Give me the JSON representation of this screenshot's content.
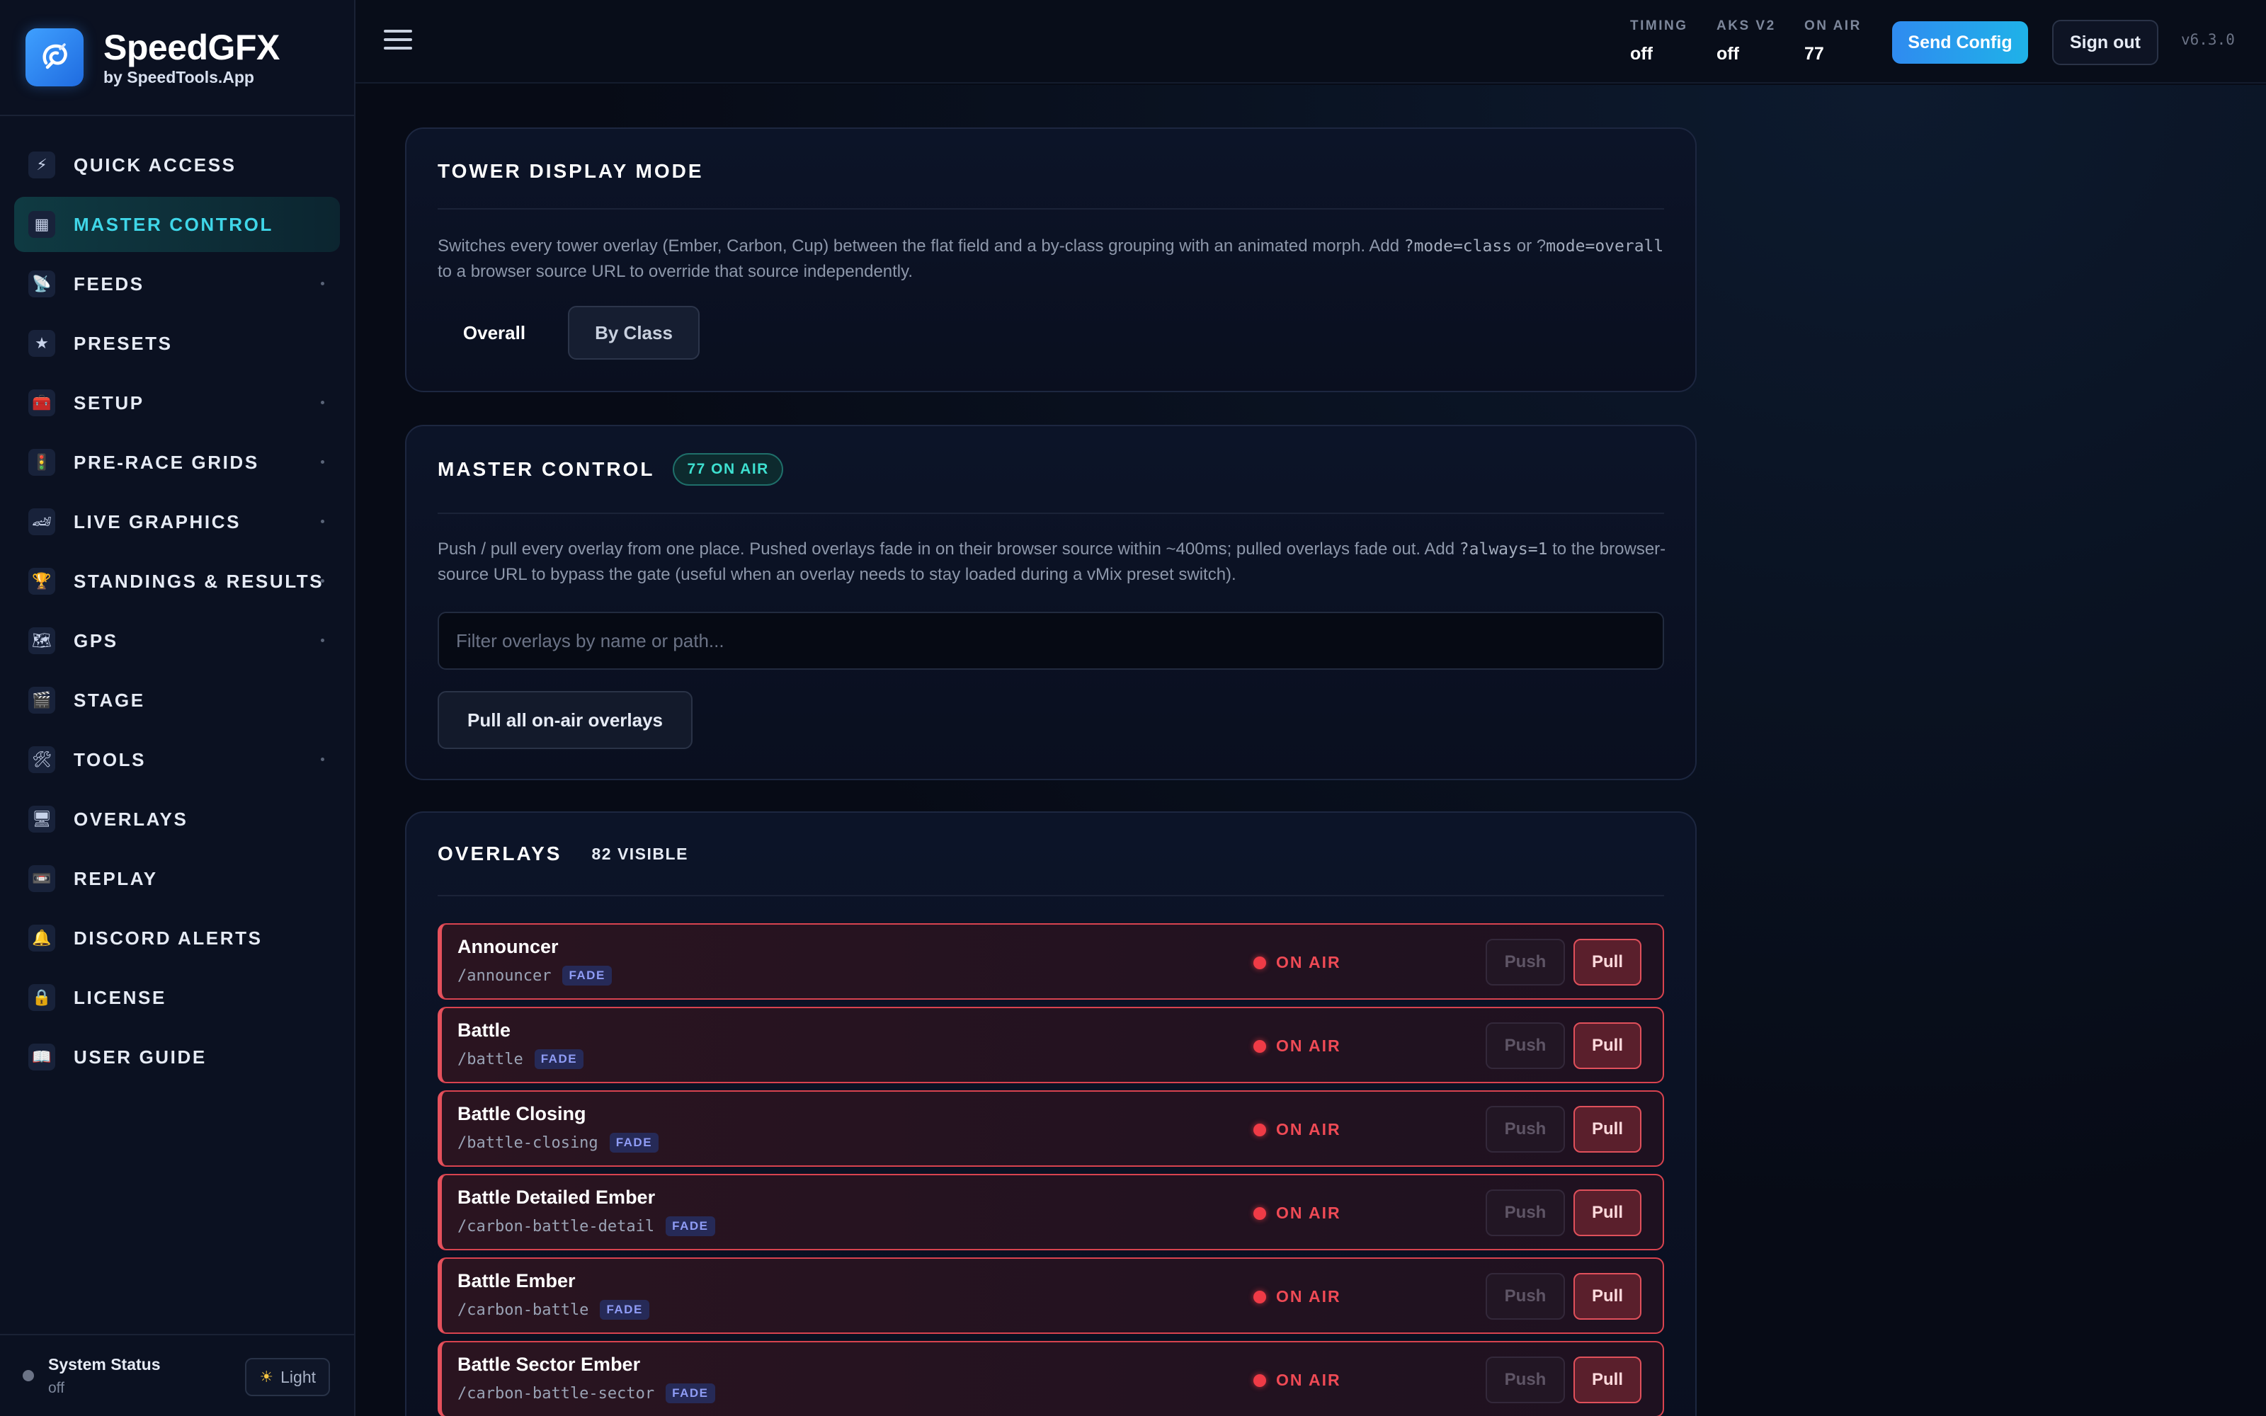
{
  "brand": {
    "name": "SpeedGFX",
    "subtitle": "by SpeedTools.App"
  },
  "sidebar": {
    "items": [
      {
        "label": "QUICK ACCESS",
        "icon": "⚡",
        "has_children": false,
        "active": false
      },
      {
        "label": "MASTER CONTROL",
        "icon": "▦",
        "has_children": false,
        "active": true
      },
      {
        "label": "FEEDS",
        "icon": "📡",
        "has_children": true,
        "active": false
      },
      {
        "label": "PRESETS",
        "icon": "★",
        "has_children": false,
        "active": false
      },
      {
        "label": "SETUP",
        "icon": "🧰",
        "has_children": true,
        "active": false
      },
      {
        "label": "PRE-RACE GRIDS",
        "icon": "🚦",
        "has_children": true,
        "active": false
      },
      {
        "label": "LIVE GRAPHICS",
        "icon": "🏎",
        "has_children": true,
        "active": false
      },
      {
        "label": "STANDINGS & RESULTS",
        "icon": "🏆",
        "has_children": true,
        "active": false
      },
      {
        "label": "GPS",
        "icon": "🗺",
        "has_children": true,
        "active": false
      },
      {
        "label": "STAGE",
        "icon": "🎬",
        "has_children": false,
        "active": false
      },
      {
        "label": "TOOLS",
        "icon": "🛠",
        "has_children": true,
        "active": false
      },
      {
        "label": "OVERLAYS",
        "icon": "🖥",
        "has_children": false,
        "active": false
      },
      {
        "label": "REPLAY",
        "icon": "📼",
        "has_children": false,
        "active": false
      },
      {
        "label": "DISCORD ALERTS",
        "icon": "🔔",
        "has_children": false,
        "active": false
      },
      {
        "label": "LICENSE",
        "icon": "🔒",
        "has_children": false,
        "active": false
      },
      {
        "label": "USER GUIDE",
        "icon": "📖",
        "has_children": false,
        "active": false
      }
    ],
    "system_status": {
      "title": "System Status",
      "value": "off"
    },
    "theme_toggle": {
      "label": "Light",
      "icon": "sun-icon"
    }
  },
  "topbar": {
    "stats": [
      {
        "label": "TIMING",
        "value": "off"
      },
      {
        "label": "AKS V2",
        "value": "off"
      },
      {
        "label": "ON AIR",
        "value": "77"
      }
    ],
    "send_config_label": "Send Config",
    "sign_out_label": "Sign out",
    "version": "v6.3.0"
  },
  "tower_mode": {
    "title": "TOWER DISPLAY MODE",
    "desc_1": "Switches every tower overlay (Ember, Carbon, Cup) between the flat field and a by-class grouping with an animated morph. Add ",
    "code_1": "?mode=class",
    "desc_2": " or ?",
    "code_2": "mode=overall",
    "desc_3": " to a browser source URL to override that source independently.",
    "overall_label": "Overall",
    "by_class_label": "By Class",
    "selected": "Overall"
  },
  "master_control": {
    "title": "MASTER CONTROL",
    "on_air_badge": "77 ON AIR",
    "desc_1": "Push / pull every overlay from one place. Pushed overlays fade in on their browser source within ~400ms; pulled overlays fade out. Add ",
    "code_1": "?always=1",
    "desc_2": " to the browser-source URL to bypass the gate (useful when an overlay needs to stay loaded during a vMix preset switch).",
    "filter_placeholder": "Filter overlays by name or path...",
    "pull_all_label": "Pull all on-air overlays"
  },
  "overlays": {
    "title": "OVERLAYS",
    "visible_count": "82 VISIBLE",
    "push_label": "Push",
    "pull_label": "Pull",
    "status_label": "ON AIR",
    "rows": [
      {
        "name": "Announcer",
        "path": "/announcer",
        "tag": "FADE"
      },
      {
        "name": "Battle",
        "path": "/battle",
        "tag": "FADE"
      },
      {
        "name": "Battle Closing",
        "path": "/battle-closing",
        "tag": "FADE"
      },
      {
        "name": "Battle Detailed Ember",
        "path": "/carbon-battle-detail",
        "tag": "FADE"
      },
      {
        "name": "Battle Ember",
        "path": "/carbon-battle",
        "tag": "FADE"
      },
      {
        "name": "Battle Sector Ember",
        "path": "/carbon-battle-sector",
        "tag": "FADE"
      }
    ]
  }
}
